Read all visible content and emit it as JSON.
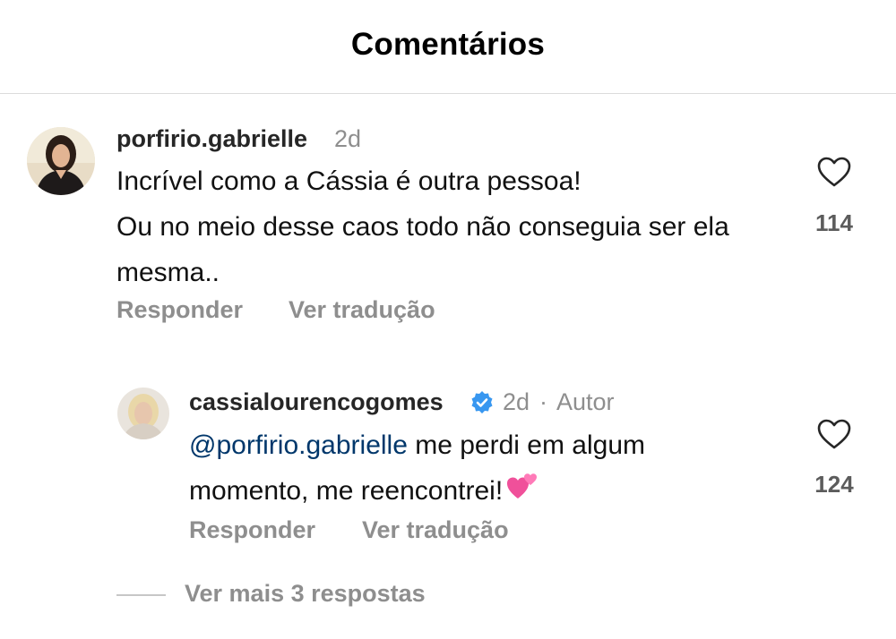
{
  "header": {
    "title": "Comentários"
  },
  "comments": [
    {
      "username": "porfirio.gabrielle",
      "time": "2d",
      "lines": [
        "Incrível como a Cássia é outra pessoa!",
        "Ou no meio desse caos todo não conseguia ser ela mesma.."
      ],
      "likes": "114",
      "reply_label": "Responder",
      "translate_label": "Ver tradução"
    },
    {
      "username": "cassialourencogomes",
      "verified": true,
      "time": "2d",
      "separator": "·",
      "author_label": "Autor",
      "mention": "@porfirio.gabrielle",
      "text": " me perdi em algum momento, me reencontrei!",
      "emoji": "two-hearts-icon",
      "likes": "124",
      "reply_label": "Responder",
      "translate_label": "Ver tradução"
    }
  ],
  "more_replies": "Ver mais 3 respostas",
  "colors": {
    "mention": "#00376b",
    "verified": "#3897f0",
    "muted": "#8e8e8e"
  }
}
